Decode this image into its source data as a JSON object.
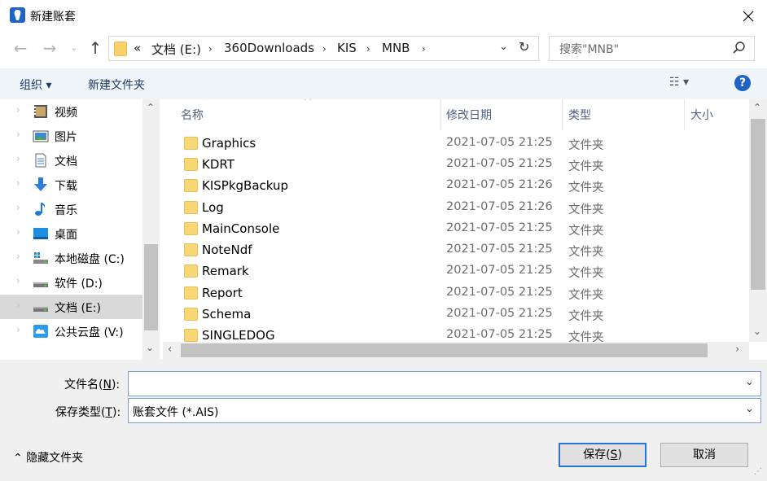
{
  "window": {
    "title": "新建账套",
    "close_glyph": "✕"
  },
  "nav": {
    "back": "←",
    "forward": "→",
    "recent": "⌄",
    "up": "↑"
  },
  "address": {
    "overflow": "«",
    "crumbs": [
      "文档 (E:)",
      "360Downloads",
      "KIS",
      "MNB"
    ],
    "separator": "›",
    "dropdown": "⌄",
    "refresh": "↻"
  },
  "search": {
    "placeholder": "搜索\"MNB\"",
    "icon": "search-icon"
  },
  "toolbar": {
    "organize": "组织 ▾",
    "new_folder": "新建文件夹",
    "view": "☷ ▾",
    "help": "?"
  },
  "navpane": {
    "items": [
      {
        "label": "视频",
        "icon": "video-icon"
      },
      {
        "label": "图片",
        "icon": "pictures-icon"
      },
      {
        "label": "文档",
        "icon": "documents-icon"
      },
      {
        "label": "下载",
        "icon": "download-icon"
      },
      {
        "label": "音乐",
        "icon": "music-icon"
      },
      {
        "label": "桌面",
        "icon": "desktop-icon"
      },
      {
        "label": "本地磁盘 (C:)",
        "icon": "drive-icon"
      },
      {
        "label": "软件 (D:)",
        "icon": "drive-icon"
      },
      {
        "label": "文档 (E:)",
        "icon": "drive-icon",
        "selected": true
      },
      {
        "label": "公共云盘 (V:)",
        "icon": "cloud-drive-icon"
      }
    ]
  },
  "filelist": {
    "columns": {
      "name": "名称",
      "date": "修改日期",
      "type": "类型",
      "size": "大小"
    },
    "rows": [
      {
        "name": "Graphics",
        "date": "2021-07-05 21:25",
        "type": "文件夹"
      },
      {
        "name": "KDRT",
        "date": "2021-07-05 21:25",
        "type": "文件夹"
      },
      {
        "name": "KISPkgBackup",
        "date": "2021-07-05 21:26",
        "type": "文件夹"
      },
      {
        "name": "Log",
        "date": "2021-07-05 21:26",
        "type": "文件夹"
      },
      {
        "name": "MainConsole",
        "date": "2021-07-05 21:25",
        "type": "文件夹"
      },
      {
        "name": "NoteNdf",
        "date": "2021-07-05 21:25",
        "type": "文件夹"
      },
      {
        "name": "Remark",
        "date": "2021-07-05 21:25",
        "type": "文件夹"
      },
      {
        "name": "Report",
        "date": "2021-07-05 21:25",
        "type": "文件夹"
      },
      {
        "name": "Schema",
        "date": "2021-07-05 21:25",
        "type": "文件夹"
      },
      {
        "name": "SINGLEDOG",
        "date": "2021-07-05 21:25",
        "type": "文件夹"
      }
    ]
  },
  "form": {
    "filename_label_pre": "文件名(",
    "filename_key": "N",
    "filename_label_post": "):",
    "filename_value": "",
    "filetype_label_pre": "保存类型(",
    "filetype_key": "T",
    "filetype_label_post": "):",
    "filetype_value": "账套文件 (*.AIS)"
  },
  "footer": {
    "hide_folders": "⌃ 隐藏文件夹",
    "save_pre": "保存(",
    "save_key": "S",
    "save_post": ")",
    "cancel": "取消"
  }
}
